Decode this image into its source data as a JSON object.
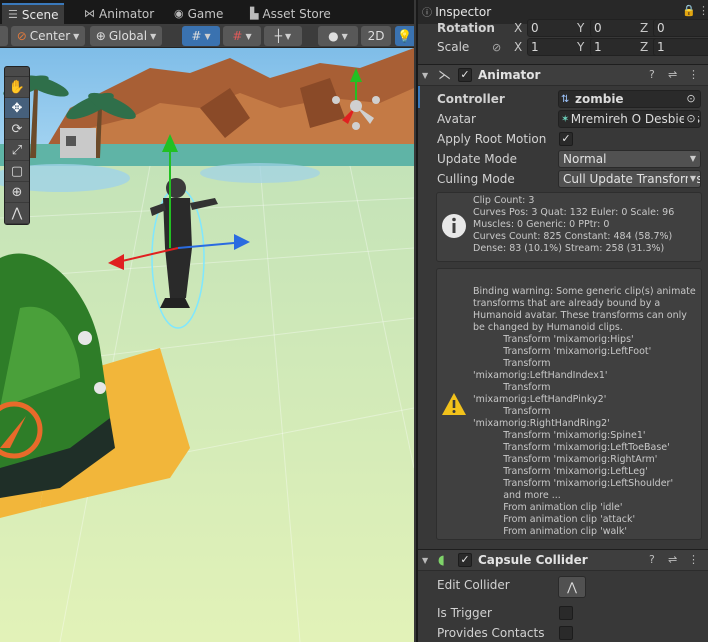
{
  "scene_tabs": [
    {
      "label": "Scene",
      "icon": "scene-icon",
      "active": true
    },
    {
      "label": "Animator",
      "icon": "animator-icon",
      "active": false
    },
    {
      "label": "Game",
      "icon": "game-icon",
      "active": false
    },
    {
      "label": "Asset Store",
      "icon": "store-icon",
      "active": false
    }
  ],
  "toolbar": {
    "pivot_label": "Center",
    "space_label": "Global",
    "mode_2d_label": "2D"
  },
  "inspector": {
    "tab_label": "Inspector",
    "rotation": {
      "label": "Rotation",
      "x": "0",
      "y": "0",
      "z": "0"
    },
    "scale": {
      "label": "Scale",
      "x": "1",
      "y": "1",
      "z": "1"
    },
    "animator": {
      "title": "Animator",
      "controller_label": "Controller",
      "controller_value": "zombie",
      "avatar_label": "Avatar",
      "avatar_value": "Mremireh O Desbiens",
      "apply_root_motion_label": "Apply Root Motion",
      "apply_root_motion": true,
      "update_mode_label": "Update Mode",
      "update_mode_value": "Normal",
      "culling_mode_label": "Culling Mode",
      "culling_mode_value": "Cull Update Transforms",
      "info_text": "Clip Count: 3\nCurves Pos: 3 Quat: 132 Euler: 0 Scale: 96\nMuscles: 0 Generic: 0 PPtr: 0\nCurves Count: 825 Constant: 484 (58.7%)\nDense: 83 (10.1%) Stream: 258 (31.3%)",
      "warning_text": "Binding warning: Some generic clip(s) animate\ntransforms that are already bound by a\nHumanoid avatar. These transforms can only\nbe changed by Humanoid clips.\n          Transform 'mixamorig:Hips'\n          Transform 'mixamorig:LeftFoot'\n          Transform\n'mixamorig:LeftHandIndex1'\n          Transform\n'mixamorig:LeftHandPinky2'\n          Transform\n'mixamorig:RightHandRing2'\n          Transform 'mixamorig:Spine1'\n          Transform 'mixamorig:LeftToeBase'\n          Transform 'mixamorig:RightArm'\n          Transform 'mixamorig:LeftLeg'\n          Transform 'mixamorig:LeftShoulder'\n          and more ...\n          From animation clip 'idle'\n          From animation clip 'attack'\n          From animation clip 'walk'"
    },
    "capsule": {
      "title": "Capsule Collider",
      "edit_collider_label": "Edit Collider",
      "is_trigger_label": "Is Trigger",
      "provides_contacts_label": "Provides Contacts"
    }
  },
  "colors": {
    "accent": "#3a79bb",
    "panel": "#383838",
    "sky": "#8ec5ee",
    "ground": "#cfe9b0"
  }
}
